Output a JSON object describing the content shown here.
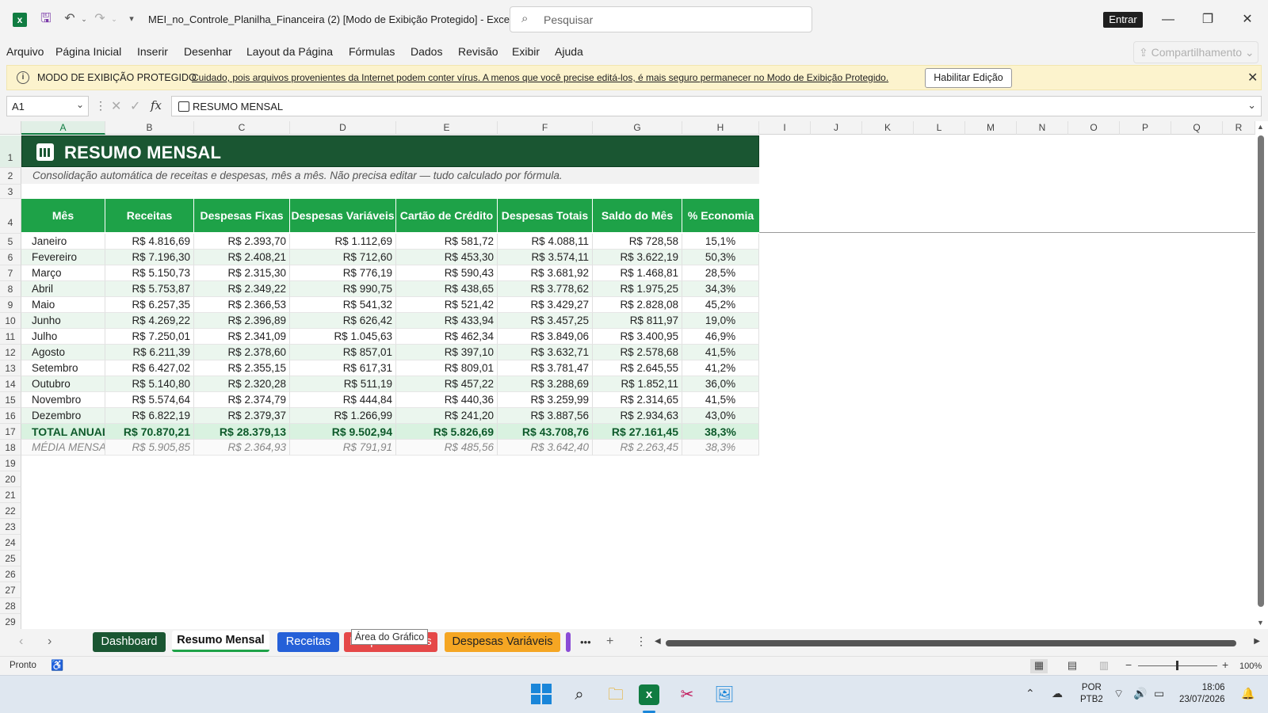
{
  "titlebar": {
    "doc_title": "MEI_no_Controle_Planilha_Financeira (2)  [Modo de Exibição Protegido]  -  Excel",
    "search_placeholder": "Pesquisar",
    "signin_label": "Entrar",
    "minimize_glyph": "—",
    "restore_glyph": "❐",
    "close_glyph": "✕"
  },
  "menu": {
    "items": [
      "Arquivo",
      "Página Inicial",
      "Inserir",
      "Desenhar",
      "Layout da Página",
      "Fórmulas",
      "Dados",
      "Revisão",
      "Exibir",
      "Ajuda"
    ],
    "share_label": "Compartilhamento"
  },
  "protected_bar": {
    "title": "MODO DE EXIBIÇÃO PROTEGIDO",
    "message": "Cuidado, pois arquivos provenientes da Internet podem conter vírus. A menos que você precise editá-los, é mais seguro permanecer no Modo de  Exibição Protegido.",
    "enable_label": "Habilitar Edição"
  },
  "formula_bar": {
    "cell_ref": "A1",
    "content": "RESUMO MENSAL"
  },
  "grid": {
    "columns": [
      "A",
      "B",
      "C",
      "D",
      "E",
      "F",
      "G",
      "H",
      "I",
      "J",
      "K",
      "L",
      "M",
      "N",
      "O",
      "P",
      "Q",
      "R"
    ],
    "row_numbers": [
      "1",
      "2",
      "3",
      "4",
      "5",
      "6",
      "7",
      "8",
      "9",
      "10",
      "11",
      "12",
      "13",
      "14",
      "15",
      "16",
      "17",
      "18",
      "19",
      "20",
      "21",
      "22",
      "23",
      "24",
      "25",
      "26",
      "27",
      "28",
      "29"
    ]
  },
  "sheet": {
    "title": "RESUMO MENSAL",
    "subtitle": "Consolidação automática de receitas e despesas, mês a mês. Não precisa editar — tudo calculado por fórmula.",
    "headers": [
      "Mês",
      "Receitas",
      "Despesas Fixas",
      "Despesas Variáveis",
      "Cartão de Crédito",
      "Despesas Totais",
      "Saldo do Mês",
      "% Economia"
    ],
    "rows": [
      [
        "Janeiro",
        "R$ 4.816,69",
        "R$ 2.393,70",
        "R$ 1.112,69",
        "R$ 581,72",
        "R$ 4.088,11",
        "R$ 728,58",
        "15,1%"
      ],
      [
        "Fevereiro",
        "R$ 7.196,30",
        "R$ 2.408,21",
        "R$ 712,60",
        "R$ 453,30",
        "R$ 3.574,11",
        "R$ 3.622,19",
        "50,3%"
      ],
      [
        "Março",
        "R$ 5.150,73",
        "R$ 2.315,30",
        "R$ 776,19",
        "R$ 590,43",
        "R$ 3.681,92",
        "R$ 1.468,81",
        "28,5%"
      ],
      [
        "Abril",
        "R$ 5.753,87",
        "R$ 2.349,22",
        "R$ 990,75",
        "R$ 438,65",
        "R$ 3.778,62",
        "R$ 1.975,25",
        "34,3%"
      ],
      [
        "Maio",
        "R$ 6.257,35",
        "R$ 2.366,53",
        "R$ 541,32",
        "R$ 521,42",
        "R$ 3.429,27",
        "R$ 2.828,08",
        "45,2%"
      ],
      [
        "Junho",
        "R$ 4.269,22",
        "R$ 2.396,89",
        "R$ 626,42",
        "R$ 433,94",
        "R$ 3.457,25",
        "R$ 811,97",
        "19,0%"
      ],
      [
        "Julho",
        "R$ 7.250,01",
        "R$ 2.341,09",
        "R$ 1.045,63",
        "R$ 462,34",
        "R$ 3.849,06",
        "R$ 3.400,95",
        "46,9%"
      ],
      [
        "Agosto",
        "R$ 6.211,39",
        "R$ 2.378,60",
        "R$ 857,01",
        "R$ 397,10",
        "R$ 3.632,71",
        "R$ 2.578,68",
        "41,5%"
      ],
      [
        "Setembro",
        "R$ 6.427,02",
        "R$ 2.355,15",
        "R$ 617,31",
        "R$ 809,01",
        "R$ 3.781,47",
        "R$ 2.645,55",
        "41,2%"
      ],
      [
        "Outubro",
        "R$ 5.140,80",
        "R$ 2.320,28",
        "R$ 511,19",
        "R$ 457,22",
        "R$ 3.288,69",
        "R$ 1.852,11",
        "36,0%"
      ],
      [
        "Novembro",
        "R$ 5.574,64",
        "R$ 2.374,79",
        "R$ 444,84",
        "R$ 440,36",
        "R$ 3.259,99",
        "R$ 2.314,65",
        "41,5%"
      ],
      [
        "Dezembro",
        "R$ 6.822,19",
        "R$ 2.379,37",
        "R$ 1.266,99",
        "R$ 241,20",
        "R$ 3.887,56",
        "R$ 2.934,63",
        "43,0%"
      ]
    ],
    "total_row": [
      "TOTAL ANUAL",
      "R$ 70.870,21",
      "R$ 28.379,13",
      "R$ 9.502,94",
      "R$ 5.826,69",
      "R$ 43.708,76",
      "R$ 27.161,45",
      "38,3%"
    ],
    "avg_row": [
      "MÉDIA MENSAL",
      "R$ 5.905,85",
      "R$ 2.364,93",
      "R$ 791,91",
      "R$ 485,56",
      "R$ 3.642,40",
      "R$ 2.263,45",
      "38,3%"
    ]
  },
  "tabs": {
    "items": [
      {
        "label": "Dashboard",
        "color": "#1a5632"
      },
      {
        "label": "Resumo Mensal",
        "color": "#ffffff"
      },
      {
        "label": "Receitas",
        "color": "#2560d8"
      },
      {
        "label": "Despesas Fixas",
        "color": "#e54848"
      },
      {
        "label": "Despesas Variáveis",
        "color": "#f5a623"
      }
    ],
    "tooltip": "Área do Gráfico",
    "more_label": "•••",
    "add_label": "+"
  },
  "status": {
    "ready": "Pronto",
    "zoom": "100%"
  },
  "taskbar": {
    "lang_top": "POR",
    "lang_bottom": "PTB2",
    "time": "18:06",
    "date": "23/07/2026"
  }
}
